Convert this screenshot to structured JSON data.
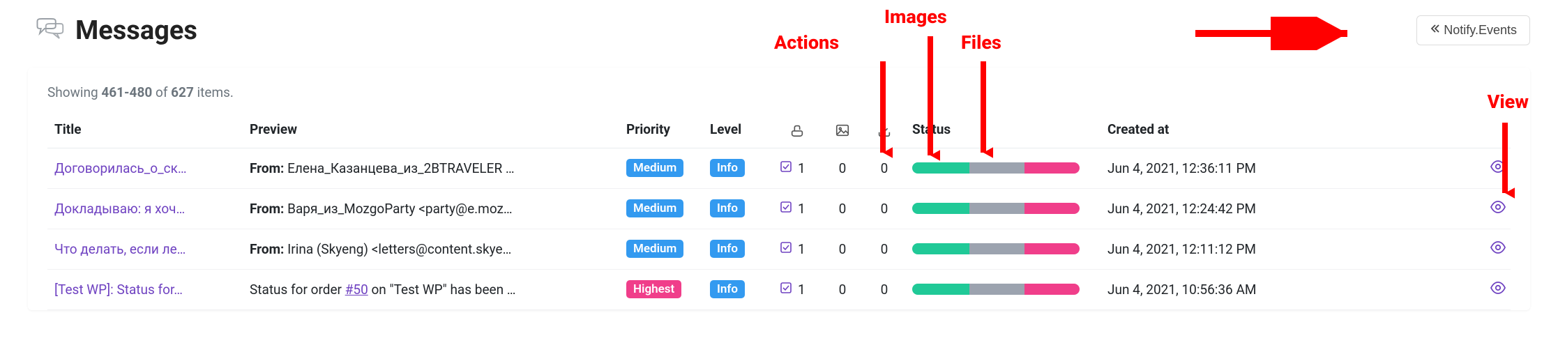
{
  "header": {
    "title": "Messages",
    "notify_btn": "Notify.Events"
  },
  "showing": {
    "prefix": "Showing ",
    "range": "461-480",
    "mid": " of ",
    "total": "627",
    "suffix": " items."
  },
  "columns": {
    "title": "Title",
    "preview": "Preview",
    "priority": "Priority",
    "level": "Level",
    "status": "Status",
    "created": "Created at"
  },
  "annotations": {
    "actions": "Actions",
    "images": "Images",
    "files": "Files",
    "view": "View"
  },
  "rows": [
    {
      "title": "Договорилась_о_ск…",
      "preview_from": "From:",
      "preview_rest": " Елена_Казанцева_из_2BTRAVELER …",
      "priority": "Medium",
      "priority_class": "badge-medium",
      "level": "Info",
      "actions": "1",
      "images": "0",
      "files": "0",
      "status_segments": [
        34,
        33,
        33
      ],
      "created": "Jun 4, 2021, 12:36:11 PM"
    },
    {
      "title": "Докладываю: я хоч…",
      "preview_from": "From:",
      "preview_rest": " Варя_из_MozgoParty <party@e.moz…",
      "priority": "Medium",
      "priority_class": "badge-medium",
      "level": "Info",
      "actions": "1",
      "images": "0",
      "files": "0",
      "status_segments": [
        34,
        33,
        33
      ],
      "created": "Jun 4, 2021, 12:24:42 PM"
    },
    {
      "title": "Что делать, если ле…",
      "preview_from": "From:",
      "preview_rest": " Irina (Skyeng) <letters@content.skye…",
      "priority": "Medium",
      "priority_class": "badge-medium",
      "level": "Info",
      "actions": "1",
      "images": "0",
      "files": "0",
      "status_segments": [
        34,
        33,
        33
      ],
      "created": "Jun 4, 2021, 12:11:12 PM"
    },
    {
      "title": "[Test WP]: Status for…",
      "preview_from": "",
      "preview_rest": "Status for order <a>#50</a> on \"Test WP\" has been …",
      "priority": "Highest",
      "priority_class": "badge-highest",
      "level": "Info",
      "actions": "1",
      "images": "0",
      "files": "0",
      "status_segments": [
        34,
        33,
        33
      ],
      "created": "Jun 4, 2021, 10:56:36 AM"
    }
  ]
}
